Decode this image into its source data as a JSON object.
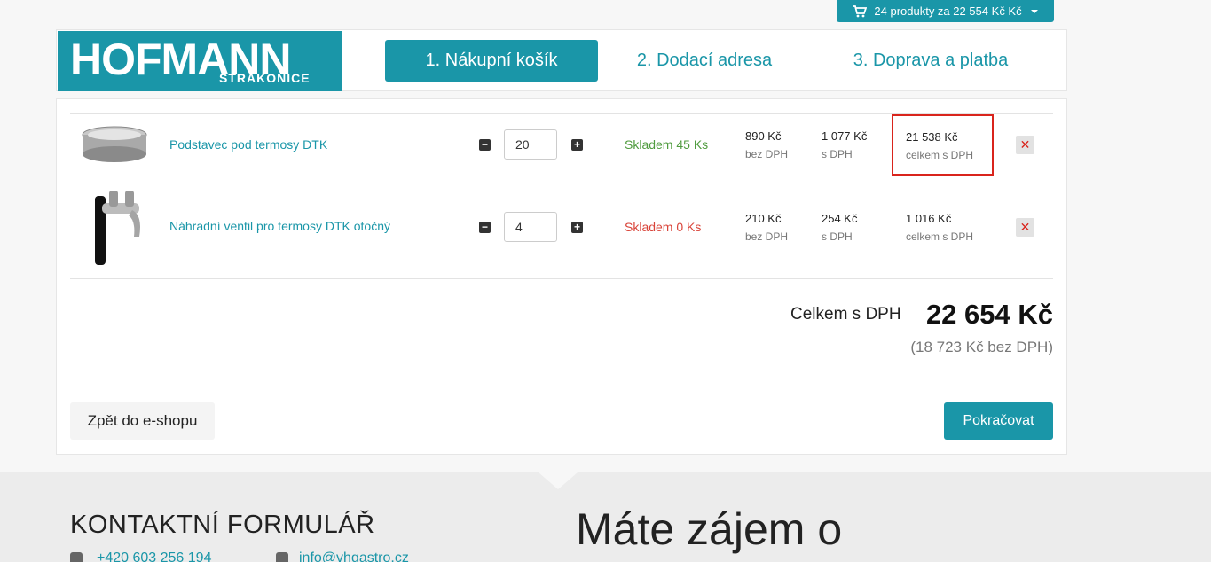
{
  "cart_summary": {
    "label": "24 produkty za 22 554 Kč Kč"
  },
  "logo": {
    "main": "HOFMANN",
    "sub": "STRAKONICE"
  },
  "steps": [
    {
      "label": "1. Nákupní košík"
    },
    {
      "label": "2. Dodací adresa"
    },
    {
      "label": "3. Doprava a platba"
    }
  ],
  "items": [
    {
      "name": "Podstavec pod termosy DTK",
      "qty": "20",
      "stock": "Skladem 45 Ks",
      "price_ex": "890 Kč",
      "price_ex_label": "bez DPH",
      "price_inc": "1 077 Kč",
      "price_inc_label": "s DPH",
      "total": "21 538 Kč",
      "total_label": "celkem s DPH"
    },
    {
      "name": "Náhradní ventil pro termosy DTK otočný",
      "qty": "4",
      "stock": "Skladem 0 Ks",
      "price_ex": "210 Kč",
      "price_ex_label": "bez DPH",
      "price_inc": "254 Kč",
      "price_inc_label": "s DPH",
      "total": "1 016 Kč",
      "total_label": "celkem s DPH"
    }
  ],
  "totals": {
    "label": "Celkem s DPH",
    "value": "22 654 Kč",
    "sub": "(18 723 Kč bez DPH)"
  },
  "buttons": {
    "back": "Zpět do e-shopu",
    "next": "Pokračovat"
  },
  "footer": {
    "title": "KONTAKTNÍ FORMULÁŘ",
    "phone": "+420 603 256 194",
    "email": "info@vhgastro.cz",
    "big_text": "Máte zájem o"
  },
  "colors": {
    "accent": "#1a96a8",
    "stock_ok": "#4f9b3e",
    "stock_no": "#d9443a",
    "highlight": "#d9241c"
  }
}
